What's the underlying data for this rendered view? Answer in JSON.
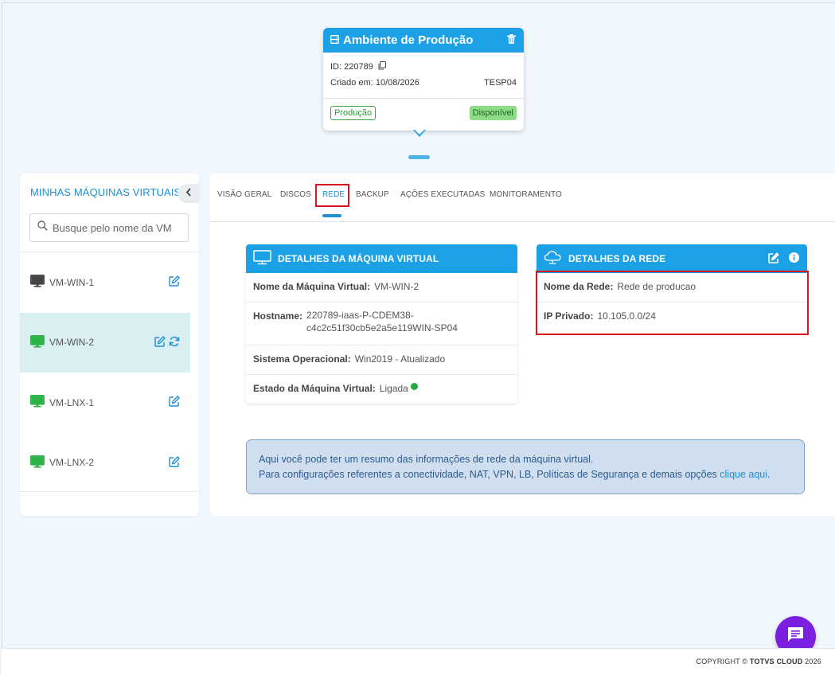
{
  "environment": {
    "title": "Ambiente de Produção",
    "id_label": "ID: 220789",
    "created_label": "Criado em: 10/08/2026",
    "code": "TESP04",
    "type_tag": "Produção",
    "status_tag": "Disponível",
    "header_color": "#1da1e6",
    "status_color": "#8fdc86"
  },
  "sidebar": {
    "title": "MINHAS MÁQUINAS VIRTUAIS",
    "search_placeholder": "Busque pelo nome da VM",
    "vms": [
      {
        "name": "VM-WIN-1",
        "icon": "monitor-icon",
        "state_color": "#444444"
      },
      {
        "name": "VM-WIN-2",
        "icon": "monitor-icon",
        "state_color": "#2db24a"
      },
      {
        "name": "VM-LNX-1",
        "icon": "monitor-icon",
        "state_color": "#2db24a"
      },
      {
        "name": "VM-LNX-2",
        "icon": "monitor-icon",
        "state_color": "#2db24a"
      }
    ]
  },
  "tabs": [
    "VISÃO GERAL",
    "DISCOS",
    "REDE",
    "BACKUP",
    "AÇÕES EXECUTADAS",
    "MONITORAMENTO"
  ],
  "active_tab": "REDE",
  "vm_details": {
    "title": "DETALHES DA MÁQUINA VIRTUAL",
    "name_label": "Nome da Máquina Virtual:",
    "name_value": "VM-WIN-2",
    "hostname_label": "Hostname:",
    "hostname_line1": "220789-iaas-P-CDEM38-",
    "hostname_line2": "c4c2c51f30cb5e2a5e119WIN-SP04",
    "os_label": "Sistema Operacional:",
    "os_value": "Win2019 - Atualizado",
    "state_label": "Estado da Máquina Virtual:",
    "state_value": "Ligada"
  },
  "network_details": {
    "title": "DETALHES DA REDE",
    "network_label": "Nome da Rede:",
    "network_value": "Rede de producao",
    "ip_label": "IP Privado:",
    "ip_value": "10.105.0.0/24"
  },
  "info": {
    "line1": "Aqui você pode ter um resumo das informações de rede da máquina virtual.",
    "line2_prefix": "Para configurações referentes a conectividade, NAT, VPN, LB, Políticas de Segurança e demais opções ",
    "link": "clique aqui",
    "line2_suffix": "."
  },
  "footer": {
    "copyright_prefix": "COPYRIGHT © ",
    "brand": "TOTVS CLOUD",
    "year": " 2026"
  },
  "colors": {
    "accent": "#1da1e6",
    "link": "#1d8fd3",
    "highlight": "#d9161e",
    "chat": "#7b1fe0"
  }
}
